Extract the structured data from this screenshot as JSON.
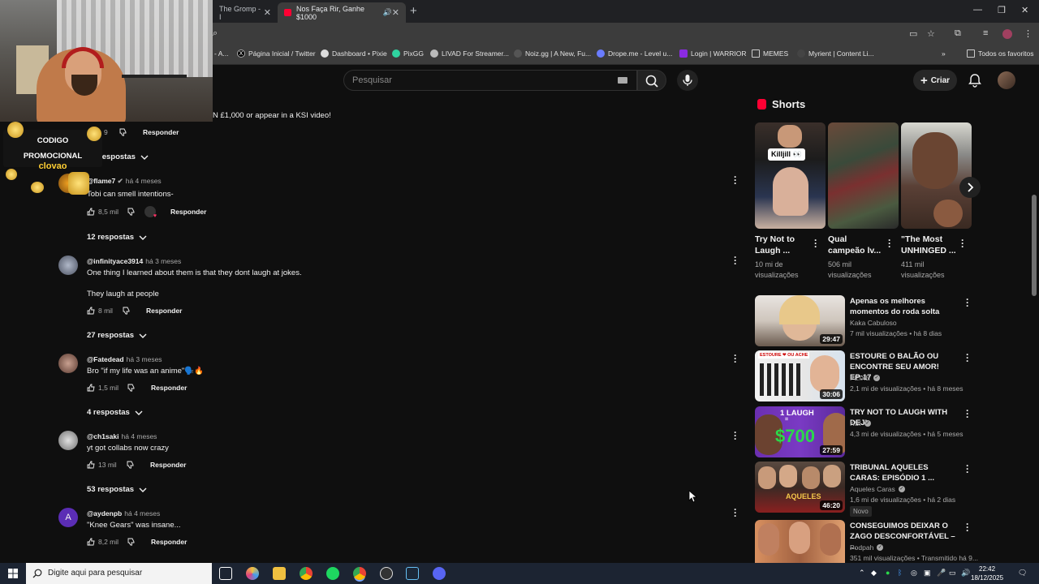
{
  "browser": {
    "tabs": [
      {
        "label": "The Gromp - I"
      },
      {
        "label": "Nos Faça Rir, Ganhe $1000"
      }
    ],
    "bookmarks": [
      "Página Inicial / Twitter",
      "Dashboard • Pixie",
      "PixGG",
      "LIVAD For Streamer...",
      "Noiz.gg | A New, Fu...",
      "Drope.me - Level u...",
      "Login | WARRIOR",
      "MEMES",
      "Myrient | Content Li..."
    ],
    "bookmark_first": "- A...",
    "all_favorites": "Todos os favoritos"
  },
  "overlay": {
    "promo_line1": "CODIGO",
    "promo_line2": "PROMOCIONAL",
    "promo_code": "clovao"
  },
  "header": {
    "search_placeholder": "Pesquisar",
    "create_label": "Criar"
  },
  "comments": {
    "top_text": "N £1,000 or appear in a KSI video!",
    "top_likes": "9",
    "top_reply": "Responder",
    "top_replies": "respostas",
    "items": [
      {
        "handle": "@flame7",
        "time": "há 4 meses",
        "text": "Tobi can smell intentions-",
        "likes": "8,5 mil",
        "reply": "Responder",
        "replies": "12 respostas"
      },
      {
        "handle": "@infinityace3914",
        "time": "há 3 meses",
        "text": "One thing I learned about them is that they dont laugh at jokes.",
        "text2": "They laugh at people",
        "likes": "8 mil",
        "reply": "Responder",
        "replies": "27 respostas"
      },
      {
        "handle": "@Fatedead",
        "time": "há 3 meses",
        "text": "Bro \"if my life was an anime\"🗣️🔥",
        "likes": "1,5 mil",
        "reply": "Responder",
        "replies": "4 respostas"
      },
      {
        "handle": "@ch1saki",
        "time": "há 4 meses",
        "text": "yt got collabs now crazy",
        "likes": "13 mil",
        "reply": "Responder",
        "replies": "53 respostas"
      },
      {
        "handle": "@aydenpb",
        "time": "há 4 meses",
        "text": "\"Knee Gears\" was insane...",
        "likes": "8,2 mil",
        "reply": "Responder",
        "avatar_letter": "A"
      }
    ]
  },
  "shorts": {
    "section_title": "Shorts",
    "thumb1_caption": "Killjill 👀",
    "items": [
      {
        "title1": "Try Not to",
        "title2": "Laugh ...",
        "views1": "10 mi de",
        "views2": "visualizações"
      },
      {
        "title1": "Qual",
        "title2": "campeão lv...",
        "views1": "506 mil",
        "views2": "visualizações"
      },
      {
        "title1": "\"The Most",
        "title2": "UNHINGED ...",
        "views1": "411 mil",
        "views2": "visualizações"
      }
    ]
  },
  "videos": [
    {
      "title": "Apenas os melhores momentos do roda solta",
      "channel": "Kaka Cabuloso",
      "views": "7 mil visualizações",
      "age": "há 8 dias",
      "duration": "29:47",
      "verified": false
    },
    {
      "title": "ESTOURE O BALÃO OU ENCONTRE SEU AMOR! EP:17",
      "channel": "PEIXE",
      "views": "2,1 mi de visualizações",
      "age": "há 8 meses",
      "duration": "30:06",
      "verified": true
    },
    {
      "title": "TRY NOT TO LAUGH WITH DEJI",
      "channel": "KSI",
      "views": "4,3 mi de visualizações",
      "age": "há 5 meses",
      "duration": "27:59",
      "verified": true,
      "thumb_text1": "1 LAUGH",
      "thumb_text2": "$700"
    },
    {
      "title": "TRIBUNAL AQUELES CARAS: EPISÓDIO 1 ...",
      "channel": "Aqueles Caras",
      "views": "1,6 mi de visualizações",
      "age": "há 2 dias",
      "duration": "46:20",
      "verified": true,
      "badge": "Novo"
    },
    {
      "title": "CONSEGUIMOS DEIXAR O ZAGO DESCONFORTÁVEL – ...",
      "channel": "Podpah",
      "views": "351 mil visualizações",
      "age": "Transmitido há 9...",
      "verified": true
    }
  ],
  "taskbar": {
    "search_placeholder": "Digite aqui para pesquisar",
    "time": "22:42",
    "date": "18/12/2025"
  },
  "colors": {
    "accent": "#ff0033",
    "background": "#0f0f0f",
    "secondary_text": "#aaaaaa"
  }
}
